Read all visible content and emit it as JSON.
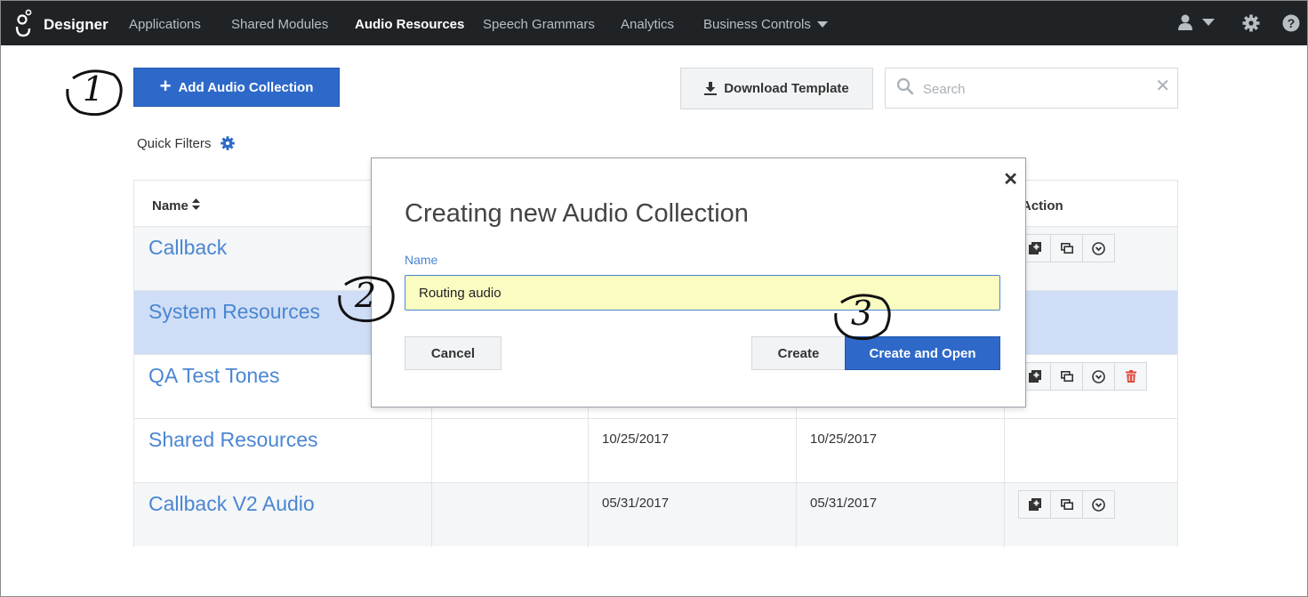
{
  "nav": {
    "brand": "Designer",
    "items": [
      {
        "label": "Applications",
        "active": false
      },
      {
        "label": "Shared Modules",
        "active": false
      },
      {
        "label": "Audio Resources",
        "active": true
      },
      {
        "label": "Speech Grammars",
        "active": false
      },
      {
        "label": "Analytics",
        "active": false
      },
      {
        "label": "Business Controls",
        "active": false
      }
    ]
  },
  "toolbar": {
    "add_label": "Add Audio Collection",
    "download_label": "Download Template",
    "search_placeholder": "Search",
    "quick_filters": "Quick Filters"
  },
  "table": {
    "headers": {
      "name": "Name",
      "action": "Action"
    },
    "rows": [
      {
        "name": "Callback",
        "date1": "",
        "date2": "",
        "actions": [
          "duplicate",
          "copy",
          "menu"
        ]
      },
      {
        "name": "System Resources",
        "date1": "",
        "date2": "",
        "actions": []
      },
      {
        "name": "QA Test Tones",
        "date1": "",
        "date2": "",
        "actions": [
          "duplicate",
          "copy",
          "menu",
          "delete"
        ]
      },
      {
        "name": "Shared Resources",
        "date1": "10/25/2017",
        "date2": "10/25/2017",
        "actions": []
      },
      {
        "name": "Callback V2 Audio",
        "date1": "05/31/2017",
        "date2": "05/31/2017",
        "actions": [
          "duplicate",
          "copy",
          "menu"
        ]
      }
    ]
  },
  "modal": {
    "title": "Creating new Audio Collection",
    "name_label": "Name",
    "name_value": "Routing audio",
    "cancel_label": "Cancel",
    "create_label": "Create",
    "create_open_label": "Create and Open"
  },
  "annotations": [
    "1",
    "2",
    "3"
  ],
  "colors": {
    "nav_bg": "#1f2326",
    "primary": "#2e69c9",
    "link": "#4a86d2",
    "selected_row": "#cfdef6",
    "input_highlight": "#fbfcc2",
    "delete": "#e04a3f"
  }
}
